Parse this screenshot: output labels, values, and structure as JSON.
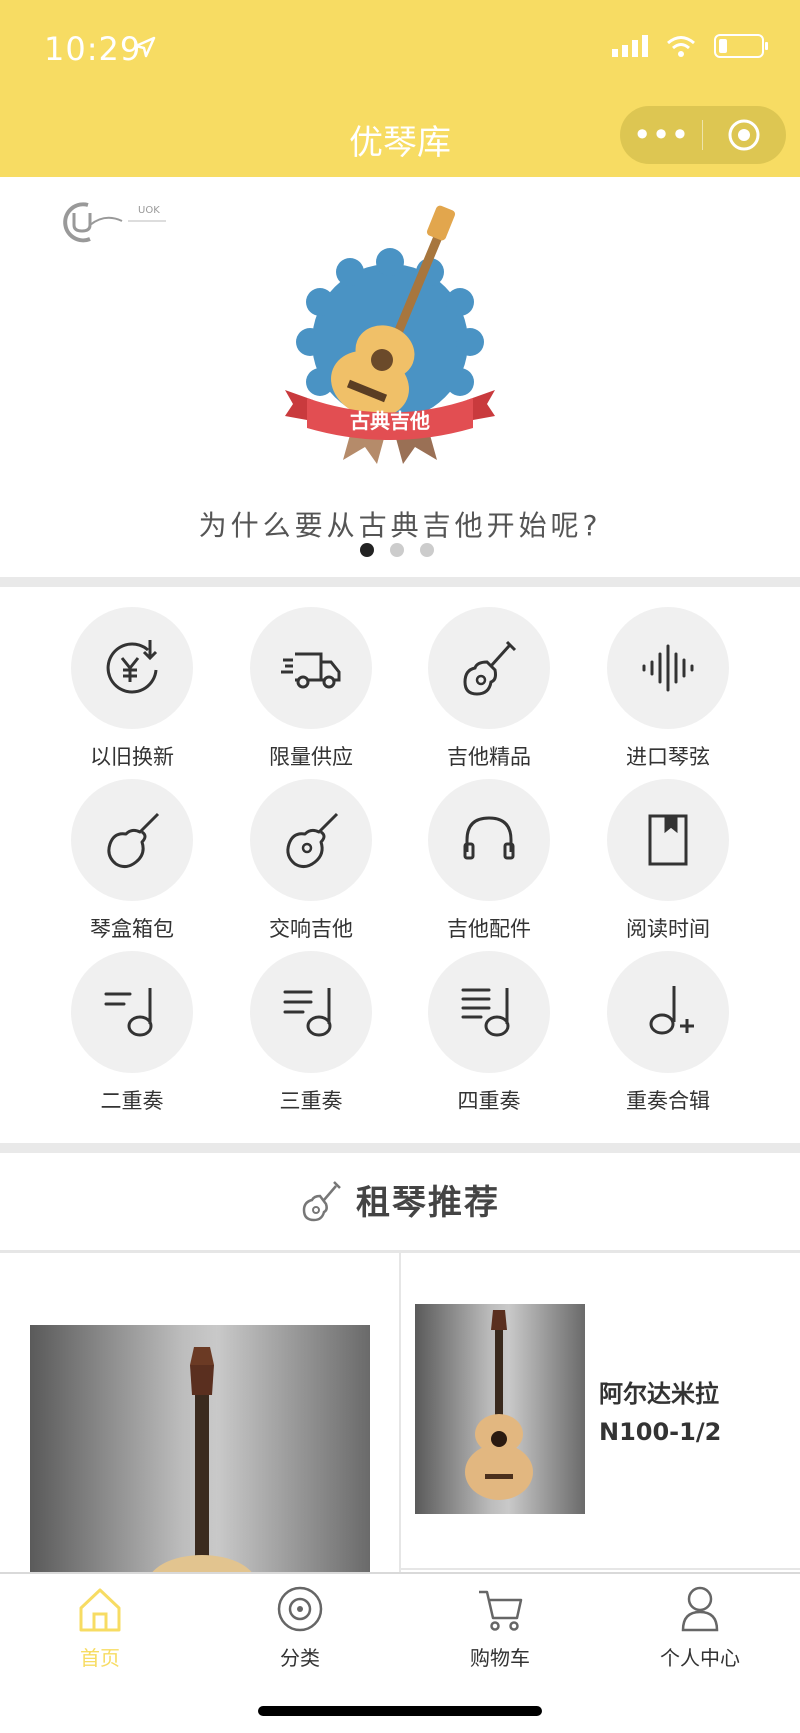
{
  "status_bar": {
    "time": "10:29"
  },
  "nav": {
    "title": "优琴库",
    "more_icon": "more-dots-icon",
    "close_icon": "target-circle-icon"
  },
  "banner": {
    "badge_text": "古典吉他",
    "caption": "为什么要从古典吉他开始呢?",
    "logo_text": "UOK"
  },
  "categories": [
    {
      "label": "以旧换新",
      "icon": "yen-recycle-icon"
    },
    {
      "label": "限量供应",
      "icon": "delivery-truck-icon"
    },
    {
      "label": "吉他精品",
      "icon": "guitar-icon"
    },
    {
      "label": "进口琴弦",
      "icon": "sound-wave-icon"
    },
    {
      "label": "琴盒箱包",
      "icon": "guitar-case-icon"
    },
    {
      "label": "交响吉他",
      "icon": "guitar-outline-icon"
    },
    {
      "label": "吉他配件",
      "icon": "headphones-icon"
    },
    {
      "label": "阅读时间",
      "icon": "book-icon"
    },
    {
      "label": "二重奏",
      "icon": "music-note-duet-icon"
    },
    {
      "label": "三重奏",
      "icon": "music-note-trio-icon"
    },
    {
      "label": "四重奏",
      "icon": "music-note-quartet-icon"
    },
    {
      "label": "重奏合辑",
      "icon": "music-note-plus-icon"
    }
  ],
  "recommend": {
    "title": "租琴推荐",
    "products": [
      {
        "name_line1": "阿尔达米拉",
        "name_line2": "N100-1/2"
      }
    ]
  },
  "tabbar": [
    {
      "label": "首页",
      "icon": "home-icon",
      "active": true
    },
    {
      "label": "分类",
      "icon": "category-disc-icon"
    },
    {
      "label": "购物车",
      "icon": "cart-icon"
    },
    {
      "label": "个人中心",
      "icon": "user-icon"
    }
  ],
  "colors": {
    "accent": "#f7dc63",
    "text": "#333333",
    "icon_bg": "#f0f0f0"
  }
}
